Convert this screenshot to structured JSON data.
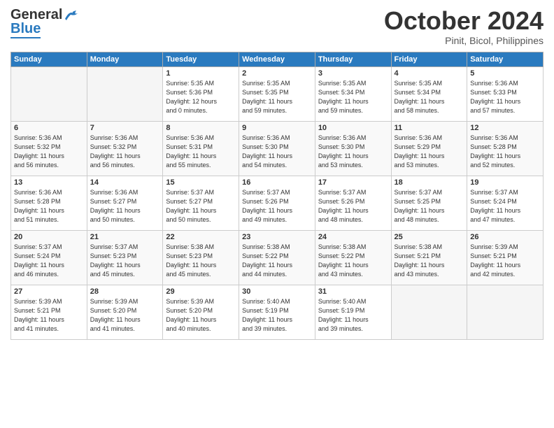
{
  "header": {
    "logo_line1": "General",
    "logo_line2": "Blue",
    "month": "October 2024",
    "location": "Pinit, Bicol, Philippines"
  },
  "days_of_week": [
    "Sunday",
    "Monday",
    "Tuesday",
    "Wednesday",
    "Thursday",
    "Friday",
    "Saturday"
  ],
  "weeks": [
    [
      {
        "num": "",
        "info": ""
      },
      {
        "num": "",
        "info": ""
      },
      {
        "num": "1",
        "info": "Sunrise: 5:35 AM\nSunset: 5:36 PM\nDaylight: 12 hours\nand 0 minutes."
      },
      {
        "num": "2",
        "info": "Sunrise: 5:35 AM\nSunset: 5:35 PM\nDaylight: 11 hours\nand 59 minutes."
      },
      {
        "num": "3",
        "info": "Sunrise: 5:35 AM\nSunset: 5:34 PM\nDaylight: 11 hours\nand 59 minutes."
      },
      {
        "num": "4",
        "info": "Sunrise: 5:35 AM\nSunset: 5:34 PM\nDaylight: 11 hours\nand 58 minutes."
      },
      {
        "num": "5",
        "info": "Sunrise: 5:36 AM\nSunset: 5:33 PM\nDaylight: 11 hours\nand 57 minutes."
      }
    ],
    [
      {
        "num": "6",
        "info": "Sunrise: 5:36 AM\nSunset: 5:32 PM\nDaylight: 11 hours\nand 56 minutes."
      },
      {
        "num": "7",
        "info": "Sunrise: 5:36 AM\nSunset: 5:32 PM\nDaylight: 11 hours\nand 56 minutes."
      },
      {
        "num": "8",
        "info": "Sunrise: 5:36 AM\nSunset: 5:31 PM\nDaylight: 11 hours\nand 55 minutes."
      },
      {
        "num": "9",
        "info": "Sunrise: 5:36 AM\nSunset: 5:30 PM\nDaylight: 11 hours\nand 54 minutes."
      },
      {
        "num": "10",
        "info": "Sunrise: 5:36 AM\nSunset: 5:30 PM\nDaylight: 11 hours\nand 53 minutes."
      },
      {
        "num": "11",
        "info": "Sunrise: 5:36 AM\nSunset: 5:29 PM\nDaylight: 11 hours\nand 53 minutes."
      },
      {
        "num": "12",
        "info": "Sunrise: 5:36 AM\nSunset: 5:28 PM\nDaylight: 11 hours\nand 52 minutes."
      }
    ],
    [
      {
        "num": "13",
        "info": "Sunrise: 5:36 AM\nSunset: 5:28 PM\nDaylight: 11 hours\nand 51 minutes."
      },
      {
        "num": "14",
        "info": "Sunrise: 5:36 AM\nSunset: 5:27 PM\nDaylight: 11 hours\nand 50 minutes."
      },
      {
        "num": "15",
        "info": "Sunrise: 5:37 AM\nSunset: 5:27 PM\nDaylight: 11 hours\nand 50 minutes."
      },
      {
        "num": "16",
        "info": "Sunrise: 5:37 AM\nSunset: 5:26 PM\nDaylight: 11 hours\nand 49 minutes."
      },
      {
        "num": "17",
        "info": "Sunrise: 5:37 AM\nSunset: 5:26 PM\nDaylight: 11 hours\nand 48 minutes."
      },
      {
        "num": "18",
        "info": "Sunrise: 5:37 AM\nSunset: 5:25 PM\nDaylight: 11 hours\nand 48 minutes."
      },
      {
        "num": "19",
        "info": "Sunrise: 5:37 AM\nSunset: 5:24 PM\nDaylight: 11 hours\nand 47 minutes."
      }
    ],
    [
      {
        "num": "20",
        "info": "Sunrise: 5:37 AM\nSunset: 5:24 PM\nDaylight: 11 hours\nand 46 minutes."
      },
      {
        "num": "21",
        "info": "Sunrise: 5:37 AM\nSunset: 5:23 PM\nDaylight: 11 hours\nand 45 minutes."
      },
      {
        "num": "22",
        "info": "Sunrise: 5:38 AM\nSunset: 5:23 PM\nDaylight: 11 hours\nand 45 minutes."
      },
      {
        "num": "23",
        "info": "Sunrise: 5:38 AM\nSunset: 5:22 PM\nDaylight: 11 hours\nand 44 minutes."
      },
      {
        "num": "24",
        "info": "Sunrise: 5:38 AM\nSunset: 5:22 PM\nDaylight: 11 hours\nand 43 minutes."
      },
      {
        "num": "25",
        "info": "Sunrise: 5:38 AM\nSunset: 5:21 PM\nDaylight: 11 hours\nand 43 minutes."
      },
      {
        "num": "26",
        "info": "Sunrise: 5:39 AM\nSunset: 5:21 PM\nDaylight: 11 hours\nand 42 minutes."
      }
    ],
    [
      {
        "num": "27",
        "info": "Sunrise: 5:39 AM\nSunset: 5:21 PM\nDaylight: 11 hours\nand 41 minutes."
      },
      {
        "num": "28",
        "info": "Sunrise: 5:39 AM\nSunset: 5:20 PM\nDaylight: 11 hours\nand 41 minutes."
      },
      {
        "num": "29",
        "info": "Sunrise: 5:39 AM\nSunset: 5:20 PM\nDaylight: 11 hours\nand 40 minutes."
      },
      {
        "num": "30",
        "info": "Sunrise: 5:40 AM\nSunset: 5:19 PM\nDaylight: 11 hours\nand 39 minutes."
      },
      {
        "num": "31",
        "info": "Sunrise: 5:40 AM\nSunset: 5:19 PM\nDaylight: 11 hours\nand 39 minutes."
      },
      {
        "num": "",
        "info": ""
      },
      {
        "num": "",
        "info": ""
      }
    ]
  ]
}
